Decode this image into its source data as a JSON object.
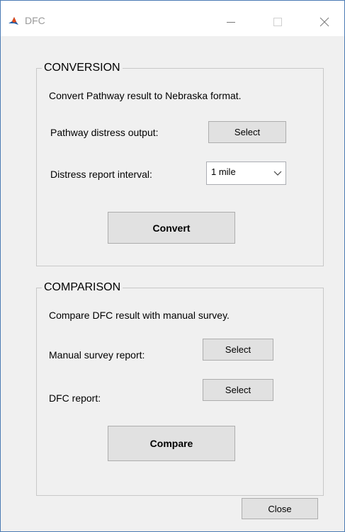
{
  "window": {
    "title": "DFC",
    "icon": "matlab-icon",
    "controls": [
      "minimize-icon",
      "maximize-icon",
      "close-icon"
    ]
  },
  "conversion": {
    "group_label": "CONVERSION",
    "description": "Convert Pathway result to Nebraska format.",
    "pathway_output_label": "Pathway distress output:",
    "select_label": "Select",
    "interval_label": "Distress report interval:",
    "interval_value": "1 mile",
    "convert_label": "Convert"
  },
  "comparison": {
    "group_label": "COMPARISON",
    "description": "Compare DFC result with manual survey.",
    "manual_report_label": "Manual survey report:",
    "manual_select_label": "Select",
    "dfc_report_label": "DFC report:",
    "dfc_select_label": "Select",
    "compare_label": "Compare"
  },
  "footer": {
    "close_label": "Close"
  }
}
